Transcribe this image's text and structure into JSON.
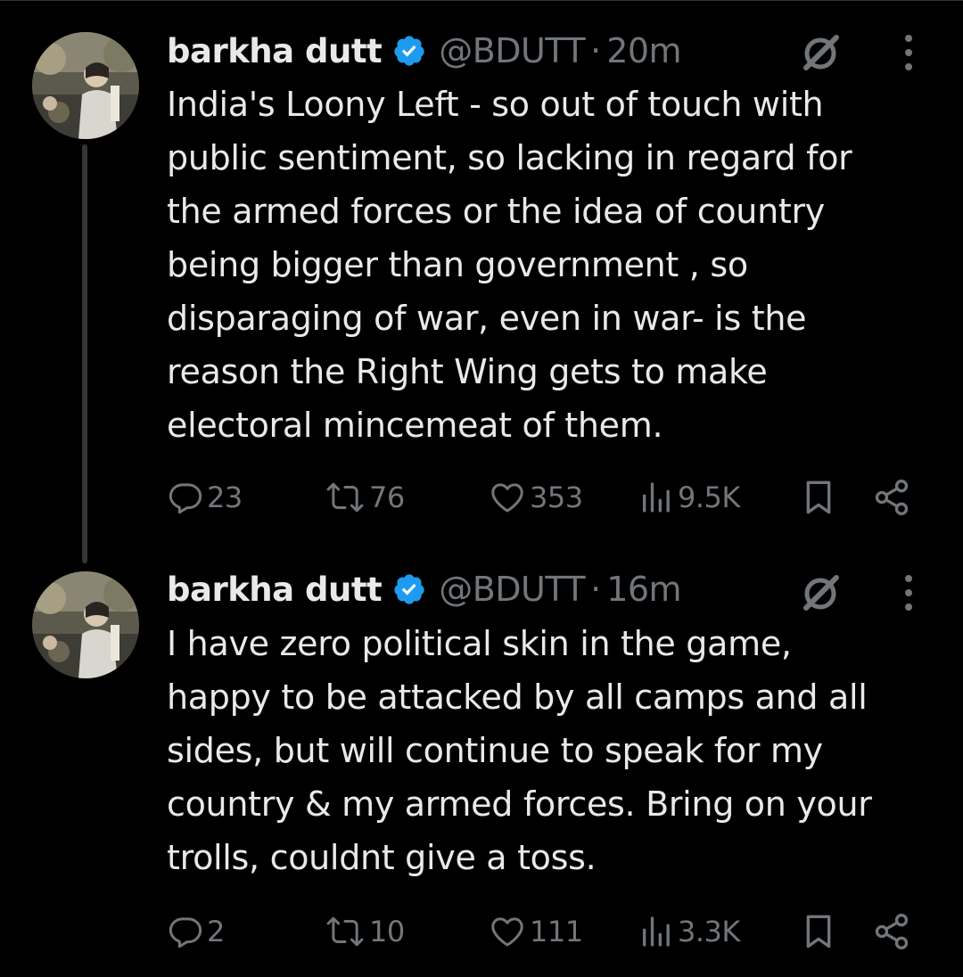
{
  "colors": {
    "background": "#000000",
    "text_primary": "#e7e9ea",
    "text_secondary": "#71767b",
    "verified_blue": "#1d9bf0",
    "thread_line": "#333639"
  },
  "tweets": [
    {
      "author_name": "barkha dutt",
      "handle": "@BDUTT",
      "separator": "·",
      "time": "20m",
      "verified": true,
      "avatar": "avatar-photo",
      "text_lines": [
        "India's Loony Left - so out of touch with",
        "public sentiment, so lacking in regard for",
        "the armed forces or the idea of country",
        "being bigger than government , so",
        "disparaging of war, even in war- is the",
        "reason the Right Wing gets to make",
        "electoral mincemeat of them."
      ],
      "stats": {
        "replies": "23",
        "reposts": "76",
        "likes": "353",
        "views": "9.5K"
      }
    },
    {
      "author_name": "barkha dutt",
      "handle": "@BDUTT",
      "separator": "·",
      "time": "16m",
      "verified": true,
      "avatar": "avatar-photo",
      "text_lines": [
        "I have zero political skin in the game,",
        "happy to be attacked by all camps and all",
        "sides, but will continue to speak for my",
        "country & my armed forces. Bring on your",
        "trolls, couldnt give a toss."
      ],
      "stats": {
        "replies": "2",
        "reposts": "10",
        "likes": "111",
        "views": "3.3K"
      }
    }
  ],
  "icons": {
    "verified": "verified-badge-icon",
    "grok": "grok-icon",
    "more": "more-options-icon",
    "reply": "reply-icon",
    "repost": "repost-icon",
    "like": "like-icon",
    "views": "views-icon",
    "bookmark": "bookmark-icon",
    "share": "share-icon"
  }
}
